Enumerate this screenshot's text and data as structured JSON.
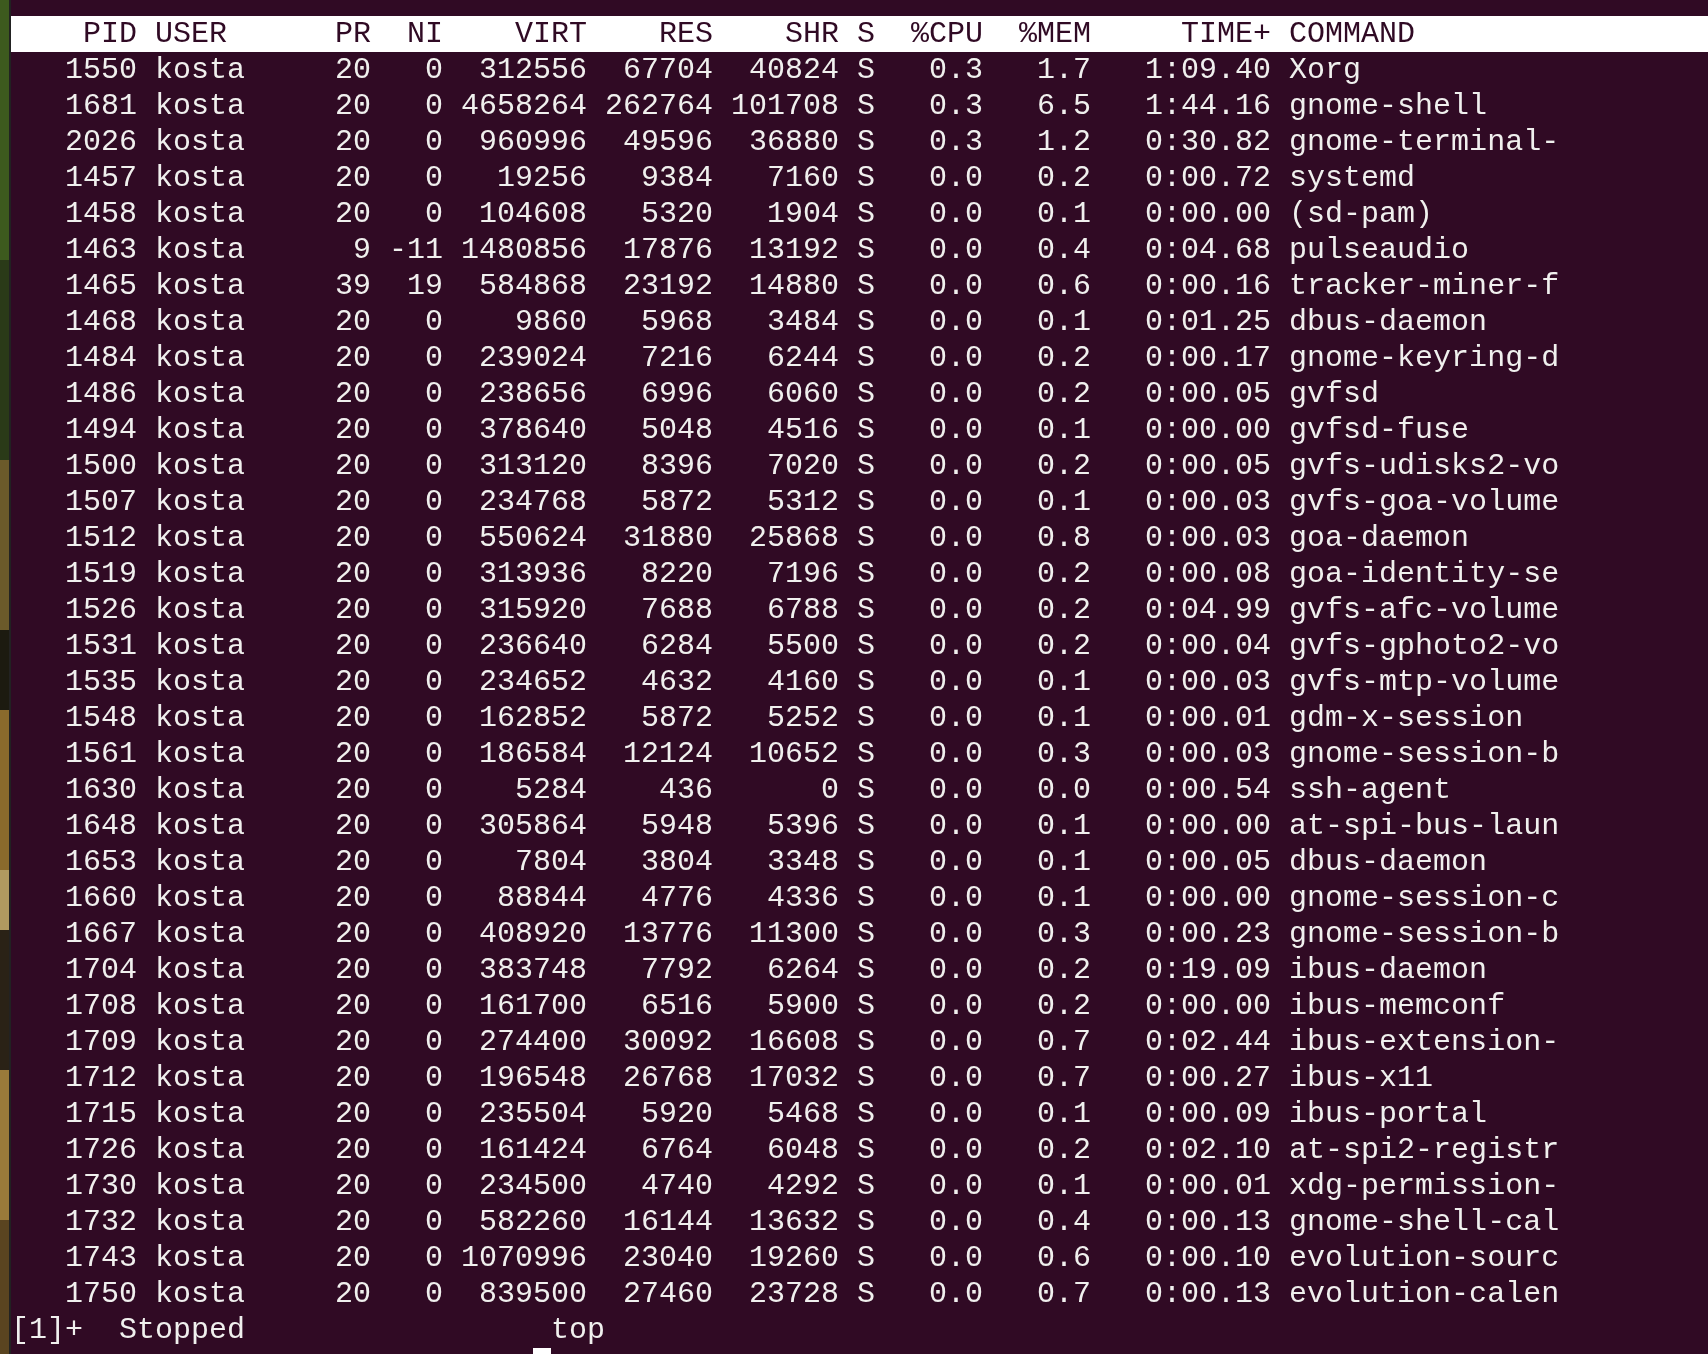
{
  "terminal": {
    "columns": [
      "PID",
      "USER",
      "PR",
      "NI",
      "VIRT",
      "RES",
      "SHR",
      "S",
      "%CPU",
      "%MEM",
      "TIME+",
      "COMMAND"
    ],
    "rows": [
      [
        "1550",
        "kosta",
        "20",
        "0",
        "312556",
        "67704",
        "40824",
        "S",
        "0.3",
        "1.7",
        "1:09.40",
        "Xorg"
      ],
      [
        "1681",
        "kosta",
        "20",
        "0",
        "4658264",
        "262764",
        "101708",
        "S",
        "0.3",
        "6.5",
        "1:44.16",
        "gnome-shell"
      ],
      [
        "2026",
        "kosta",
        "20",
        "0",
        "960996",
        "49596",
        "36880",
        "S",
        "0.3",
        "1.2",
        "0:30.82",
        "gnome-terminal-"
      ],
      [
        "1457",
        "kosta",
        "20",
        "0",
        "19256",
        "9384",
        "7160",
        "S",
        "0.0",
        "0.2",
        "0:00.72",
        "systemd"
      ],
      [
        "1458",
        "kosta",
        "20",
        "0",
        "104608",
        "5320",
        "1904",
        "S",
        "0.0",
        "0.1",
        "0:00.00",
        "(sd-pam)"
      ],
      [
        "1463",
        "kosta",
        "9",
        "-11",
        "1480856",
        "17876",
        "13192",
        "S",
        "0.0",
        "0.4",
        "0:04.68",
        "pulseaudio"
      ],
      [
        "1465",
        "kosta",
        "39",
        "19",
        "584868",
        "23192",
        "14880",
        "S",
        "0.0",
        "0.6",
        "0:00.16",
        "tracker-miner-f"
      ],
      [
        "1468",
        "kosta",
        "20",
        "0",
        "9860",
        "5968",
        "3484",
        "S",
        "0.0",
        "0.1",
        "0:01.25",
        "dbus-daemon"
      ],
      [
        "1484",
        "kosta",
        "20",
        "0",
        "239024",
        "7216",
        "6244",
        "S",
        "0.0",
        "0.2",
        "0:00.17",
        "gnome-keyring-d"
      ],
      [
        "1486",
        "kosta",
        "20",
        "0",
        "238656",
        "6996",
        "6060",
        "S",
        "0.0",
        "0.2",
        "0:00.05",
        "gvfsd"
      ],
      [
        "1494",
        "kosta",
        "20",
        "0",
        "378640",
        "5048",
        "4516",
        "S",
        "0.0",
        "0.1",
        "0:00.00",
        "gvfsd-fuse"
      ],
      [
        "1500",
        "kosta",
        "20",
        "0",
        "313120",
        "8396",
        "7020",
        "S",
        "0.0",
        "0.2",
        "0:00.05",
        "gvfs-udisks2-vo"
      ],
      [
        "1507",
        "kosta",
        "20",
        "0",
        "234768",
        "5872",
        "5312",
        "S",
        "0.0",
        "0.1",
        "0:00.03",
        "gvfs-goa-volume"
      ],
      [
        "1512",
        "kosta",
        "20",
        "0",
        "550624",
        "31880",
        "25868",
        "S",
        "0.0",
        "0.8",
        "0:00.03",
        "goa-daemon"
      ],
      [
        "1519",
        "kosta",
        "20",
        "0",
        "313936",
        "8220",
        "7196",
        "S",
        "0.0",
        "0.2",
        "0:00.08",
        "goa-identity-se"
      ],
      [
        "1526",
        "kosta",
        "20",
        "0",
        "315920",
        "7688",
        "6788",
        "S",
        "0.0",
        "0.2",
        "0:04.99",
        "gvfs-afc-volume"
      ],
      [
        "1531",
        "kosta",
        "20",
        "0",
        "236640",
        "6284",
        "5500",
        "S",
        "0.0",
        "0.2",
        "0:00.04",
        "gvfs-gphoto2-vo"
      ],
      [
        "1535",
        "kosta",
        "20",
        "0",
        "234652",
        "4632",
        "4160",
        "S",
        "0.0",
        "0.1",
        "0:00.03",
        "gvfs-mtp-volume"
      ],
      [
        "1548",
        "kosta",
        "20",
        "0",
        "162852",
        "5872",
        "5252",
        "S",
        "0.0",
        "0.1",
        "0:00.01",
        "gdm-x-session"
      ],
      [
        "1561",
        "kosta",
        "20",
        "0",
        "186584",
        "12124",
        "10652",
        "S",
        "0.0",
        "0.3",
        "0:00.03",
        "gnome-session-b"
      ],
      [
        "1630",
        "kosta",
        "20",
        "0",
        "5284",
        "436",
        "0",
        "S",
        "0.0",
        "0.0",
        "0:00.54",
        "ssh-agent"
      ],
      [
        "1648",
        "kosta",
        "20",
        "0",
        "305864",
        "5948",
        "5396",
        "S",
        "0.0",
        "0.1",
        "0:00.00",
        "at-spi-bus-laun"
      ],
      [
        "1653",
        "kosta",
        "20",
        "0",
        "7804",
        "3804",
        "3348",
        "S",
        "0.0",
        "0.1",
        "0:00.05",
        "dbus-daemon"
      ],
      [
        "1660",
        "kosta",
        "20",
        "0",
        "88844",
        "4776",
        "4336",
        "S",
        "0.0",
        "0.1",
        "0:00.00",
        "gnome-session-c"
      ],
      [
        "1667",
        "kosta",
        "20",
        "0",
        "408920",
        "13776",
        "11300",
        "S",
        "0.0",
        "0.3",
        "0:00.23",
        "gnome-session-b"
      ],
      [
        "1704",
        "kosta",
        "20",
        "0",
        "383748",
        "7792",
        "6264",
        "S",
        "0.0",
        "0.2",
        "0:19.09",
        "ibus-daemon"
      ],
      [
        "1708",
        "kosta",
        "20",
        "0",
        "161700",
        "6516",
        "5900",
        "S",
        "0.0",
        "0.2",
        "0:00.00",
        "ibus-memconf"
      ],
      [
        "1709",
        "kosta",
        "20",
        "0",
        "274400",
        "30092",
        "16608",
        "S",
        "0.0",
        "0.7",
        "0:02.44",
        "ibus-extension-"
      ],
      [
        "1712",
        "kosta",
        "20",
        "0",
        "196548",
        "26768",
        "17032",
        "S",
        "0.0",
        "0.7",
        "0:00.27",
        "ibus-x11"
      ],
      [
        "1715",
        "kosta",
        "20",
        "0",
        "235504",
        "5920",
        "5468",
        "S",
        "0.0",
        "0.1",
        "0:00.09",
        "ibus-portal"
      ],
      [
        "1726",
        "kosta",
        "20",
        "0",
        "161424",
        "6764",
        "6048",
        "S",
        "0.0",
        "0.2",
        "0:02.10",
        "at-spi2-registr"
      ],
      [
        "1730",
        "kosta",
        "20",
        "0",
        "234500",
        "4740",
        "4292",
        "S",
        "0.0",
        "0.1",
        "0:00.01",
        "xdg-permission-"
      ],
      [
        "1732",
        "kosta",
        "20",
        "0",
        "582260",
        "16144",
        "13632",
        "S",
        "0.0",
        "0.4",
        "0:00.13",
        "gnome-shell-cal"
      ],
      [
        "1743",
        "kosta",
        "20",
        "0",
        "1070996",
        "23040",
        "19260",
        "S",
        "0.0",
        "0.6",
        "0:00.10",
        "evolution-sourc"
      ],
      [
        "1750",
        "kosta",
        "20",
        "0",
        "839500",
        "27460",
        "23728",
        "S",
        "0.0",
        "0.7",
        "0:00.13",
        "evolution-calen"
      ]
    ],
    "job": {
      "number": "[1]+",
      "status": "Stopped",
      "command": "top"
    }
  }
}
